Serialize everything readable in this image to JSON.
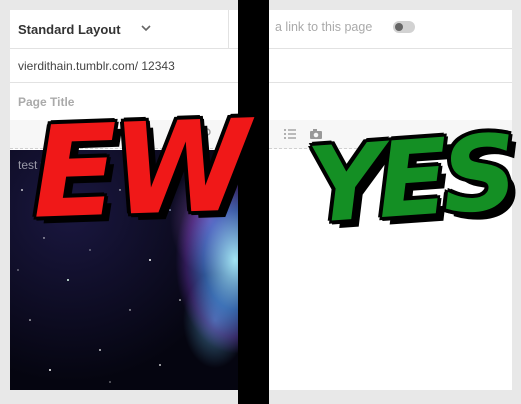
{
  "left_editor": {
    "layout_select": "Standard Layout",
    "url": "vierdithain.tumblr.com/ 12343",
    "title_placeholder": "Page Title",
    "body_text": "test te"
  },
  "right_editor": {
    "share_text": "a link to this page"
  },
  "overlay": {
    "left_word": "EW",
    "right_word": "YES"
  },
  "colors": {
    "ew_fill": "#f01818",
    "yes_fill": "#148f24",
    "divider": "#000000"
  }
}
